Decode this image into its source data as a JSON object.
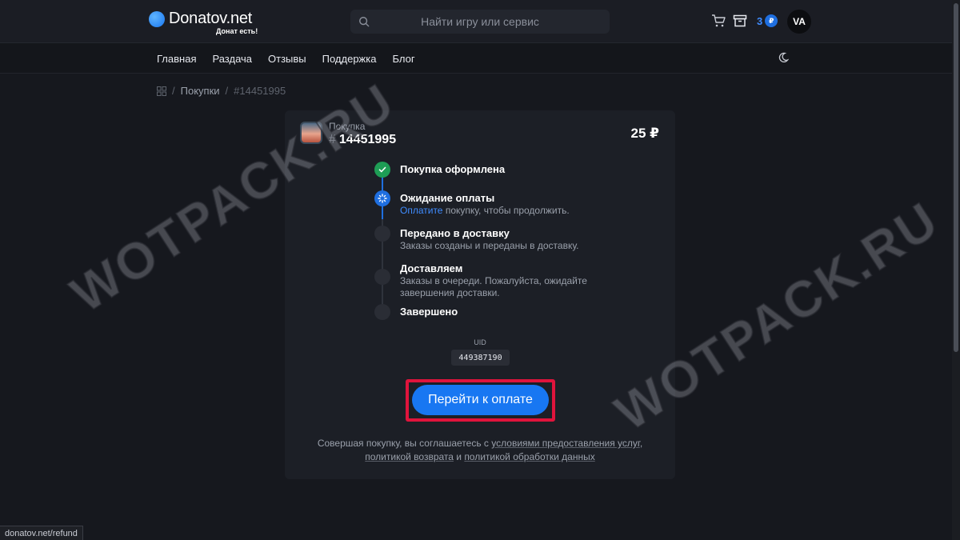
{
  "header": {
    "logo_text": "Donatov.net",
    "logo_subtitle": "Донат есть!",
    "search_placeholder": "Найти игру или сервис",
    "balance": "3",
    "coin_symbol": "₽",
    "avatar_initials": "VA"
  },
  "nav": {
    "items": [
      "Главная",
      "Раздача",
      "Отзывы",
      "Поддержка",
      "Блог"
    ]
  },
  "breadcrumb": {
    "parent": "Покупки",
    "current": "#14451995"
  },
  "order": {
    "label": "Покупка",
    "hash": "#",
    "number": "14451995",
    "price": "25 ₽"
  },
  "steps": [
    {
      "title": "Покупка оформлена",
      "desc": "",
      "state": "done"
    },
    {
      "title": "Ожидание оплаты",
      "desc_link": "Оплатите",
      "desc": " покупку, чтобы продолжить.",
      "state": "active"
    },
    {
      "title": "Передано в доставку",
      "desc": "Заказы созданы и переданы в доставку.",
      "state": "pending"
    },
    {
      "title": "Доставляем",
      "desc": "Заказы в очереди. Пожалуйста, ожидайте завершения доставки.",
      "state": "pending"
    },
    {
      "title": "Завершено",
      "desc": "",
      "state": "pending"
    }
  ],
  "uid": {
    "label": "UID",
    "value": "449387190"
  },
  "pay_button_label": "Перейти к оплате",
  "legal": {
    "prefix": "Совершая покупку, вы соглашаетесь с ",
    "terms_link": "условиями предоставления услуг",
    "comma": ",",
    "refund_link": "политикой возврата",
    "and": " и ",
    "privacy_link": "политикой обработки данных"
  },
  "watermark": "WOTPACK.RU",
  "status_url": "donatov.net/refund",
  "colors": {
    "accent": "#1877f2",
    "success": "#1e9d55",
    "highlight_frame": "#e0143c",
    "background": "#16181e",
    "card": "#1c1f26"
  }
}
